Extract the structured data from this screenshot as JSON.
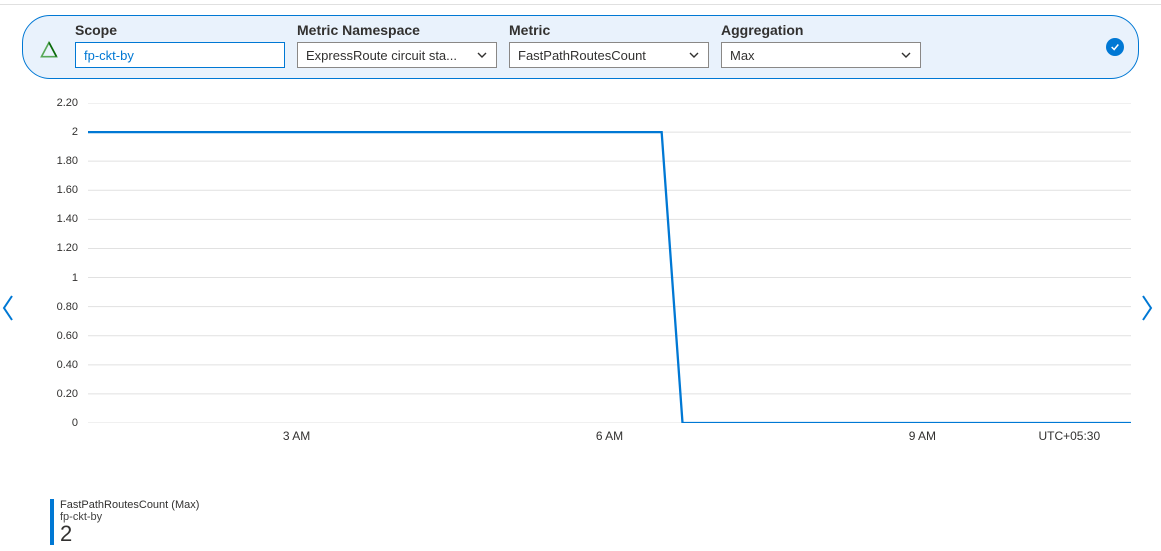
{
  "filters": {
    "scope": {
      "label": "Scope",
      "value": "fp-ckt-by"
    },
    "namespace": {
      "label": "Metric Namespace",
      "value": "ExpressRoute circuit sta..."
    },
    "metric": {
      "label": "Metric",
      "value": "FastPathRoutesCount"
    },
    "aggregation": {
      "label": "Aggregation",
      "value": "Max"
    }
  },
  "legend": {
    "title": "FastPathRoutesCount (Max)",
    "subtitle": "fp-ckt-by",
    "value": "2"
  },
  "x_ticks": [
    "3 AM",
    "6 AM",
    "9 AM"
  ],
  "timezone": "UTC+05:30",
  "y_ticks": [
    "2.20",
    "2",
    "1.80",
    "1.60",
    "1.40",
    "1.20",
    "1",
    "0.80",
    "0.60",
    "0.40",
    "0.20",
    "0"
  ],
  "chart_data": {
    "type": "line",
    "title": "FastPathRoutesCount (Max)",
    "ylabel": "",
    "xlabel": "",
    "ylim": [
      0,
      2.2
    ],
    "x_hours": [
      1,
      2,
      3,
      4,
      5,
      6,
      6.5,
      6.7,
      7,
      8,
      9,
      10,
      11
    ],
    "values": [
      2,
      2,
      2,
      2,
      2,
      2,
      2,
      0,
      0,
      0,
      0,
      0,
      0
    ],
    "series": [
      {
        "name": "FastPathRoutesCount (Max)",
        "scope": "fp-ckt-by"
      }
    ]
  }
}
